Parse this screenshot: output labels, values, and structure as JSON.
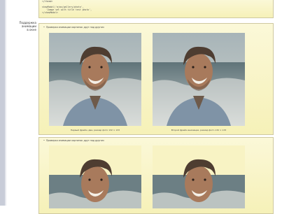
{
  "sidebar": {
    "label_line1": "Поддержка анимации",
    "label_line2": "в окне"
  },
  "top_panel": {
    "code_lines": [
      "</thead>",
      "",
      "showModal('ajax/gallery/photo',",
      "   'Image set with title test photo',",
      "</showModal>"
    ]
  },
  "panel1": {
    "note": "Проверка анимации картинок друг над другом",
    "images": [
      {
        "icon": "portrait-photo",
        "caption": "Первый фрейм, два, размер фото 132 × 133"
      },
      {
        "icon": "portrait-photo",
        "caption": "Второй фрейм анимации, размер фото 132 × 133"
      }
    ]
  },
  "panel2": {
    "note": "Проверка анимации картинок друг над другом",
    "images": [
      {
        "icon": "portrait-photo"
      },
      {
        "icon": "portrait-photo"
      }
    ]
  }
}
